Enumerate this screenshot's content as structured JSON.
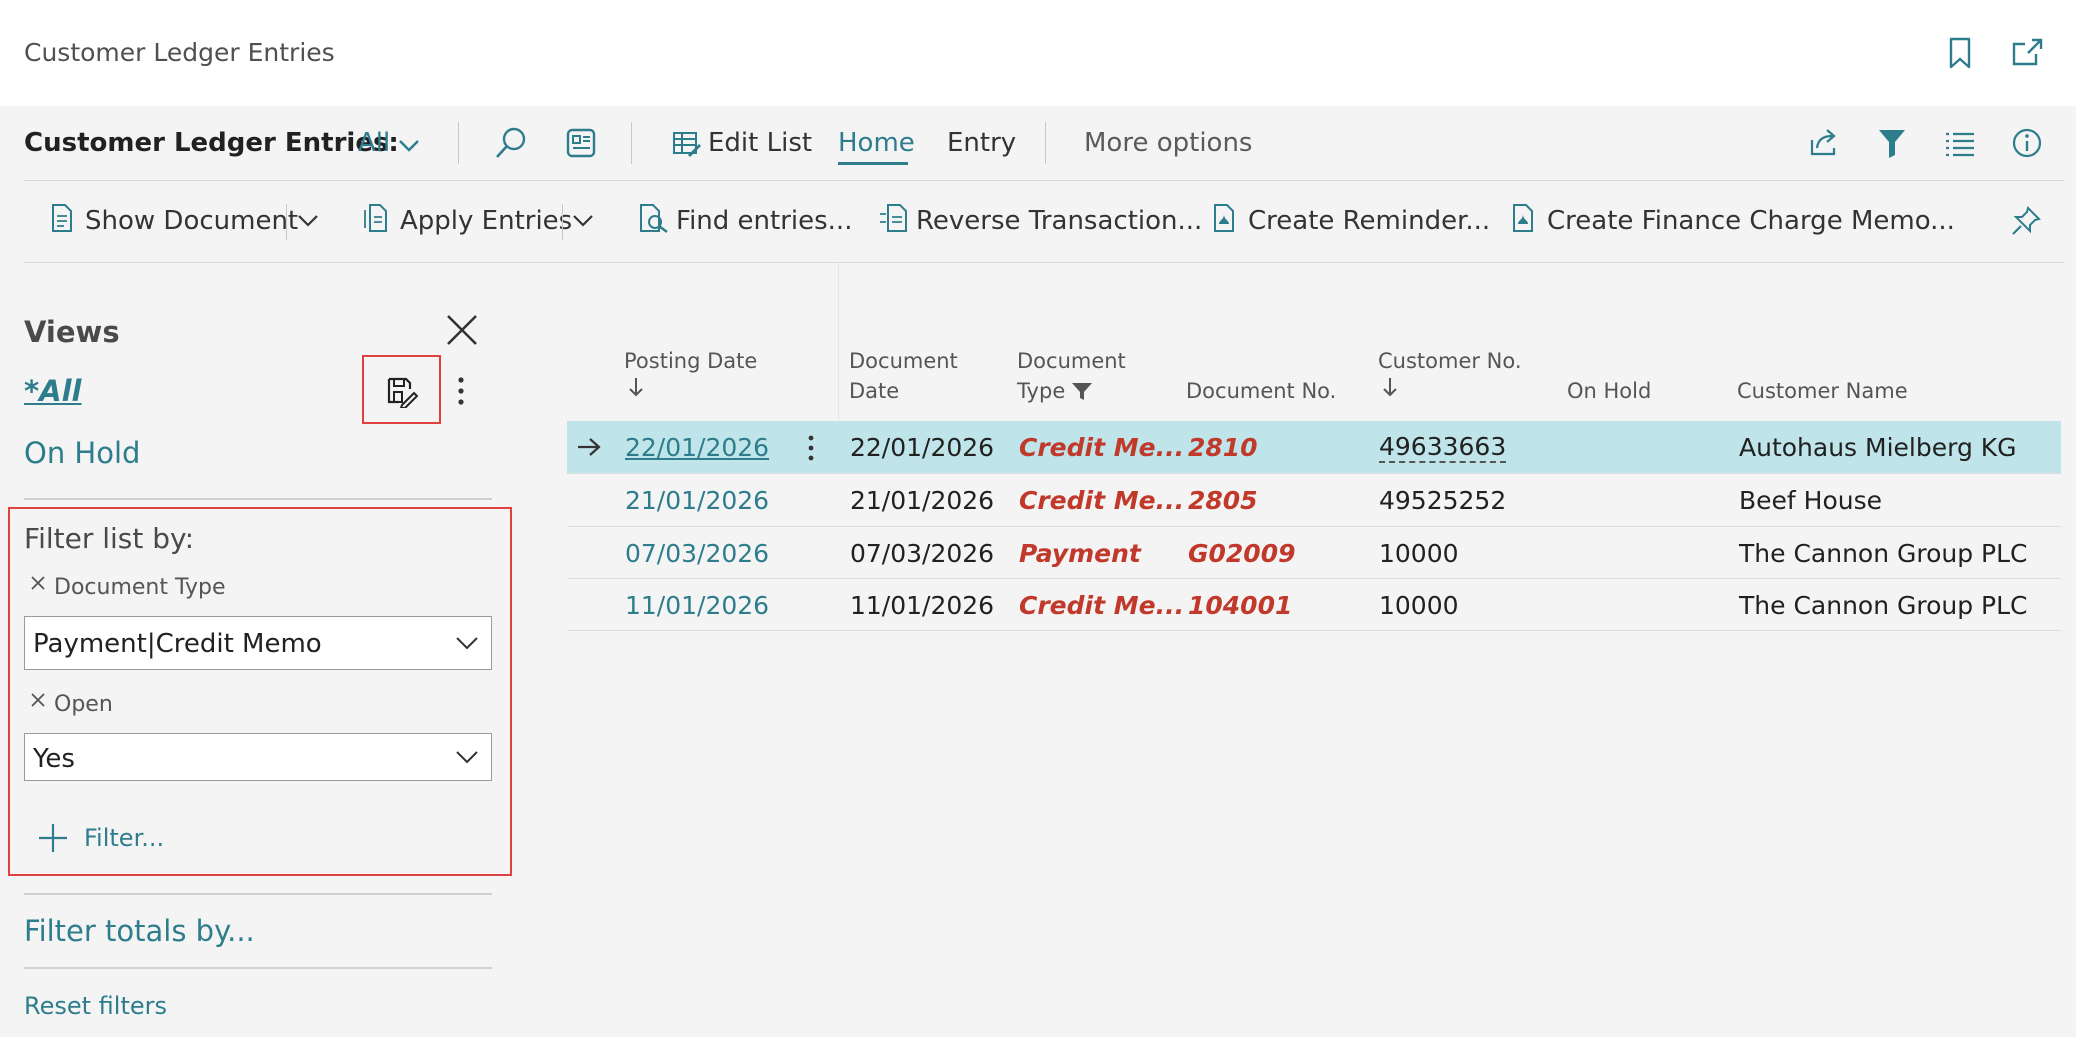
{
  "window": {
    "title": "Customer Ledger Entries"
  },
  "action_bar": {
    "caption": "Customer Ledger Entries:",
    "current_view": "All",
    "edit_list": "Edit List",
    "tab_home": "Home",
    "tab_entry": "Entry",
    "more_options": "More options"
  },
  "promoted_actions": {
    "show_document": "Show Document",
    "apply_entries": "Apply Entries",
    "find_entries": "Find entries...",
    "reverse_transaction": "Reverse Transaction...",
    "create_reminder": "Create Reminder...",
    "create_finance_charge_memo": "Create Finance Charge Memo..."
  },
  "views_pane": {
    "title": "Views",
    "views": [
      "*All",
      "On Hold"
    ],
    "filter_list_by": "Filter list by:",
    "filters": [
      {
        "field": "Document Type",
        "value": "Payment|Credit Memo"
      },
      {
        "field": "Open",
        "value": "Yes"
      }
    ],
    "add_filter": "Filter...",
    "filter_totals_by": "Filter totals by...",
    "reset_filters": "Reset filters"
  },
  "grid": {
    "columns": {
      "posting_date": "Posting Date",
      "document_date_1": "Document",
      "document_date_2": "Date",
      "document_type_1": "Document",
      "document_type_2": "Type",
      "document_no": "Document No.",
      "customer_no": "Customer No.",
      "on_hold": "On Hold",
      "customer_name": "Customer Name"
    },
    "rows": [
      {
        "posting_date": "22/01/2026",
        "document_date": "22/01/2026",
        "document_type": "Credit Me...",
        "document_no": "2810",
        "customer_no": "49633663",
        "on_hold": "",
        "customer_name": "Autohaus Mielberg KG"
      },
      {
        "posting_date": "21/01/2026",
        "document_date": "21/01/2026",
        "document_type": "Credit Me...",
        "document_no": "2805",
        "customer_no": "49525252",
        "on_hold": "",
        "customer_name": "Beef House"
      },
      {
        "posting_date": "07/03/2026",
        "document_date": "07/03/2026",
        "document_type": "Payment",
        "document_no": "G02009",
        "customer_no": "10000",
        "on_hold": "",
        "customer_name": "The Cannon Group PLC"
      },
      {
        "posting_date": "11/01/2026",
        "document_date": "11/01/2026",
        "document_type": "Credit Me...",
        "document_no": "104001",
        "customer_no": "10000",
        "on_hold": "",
        "customer_name": "The Cannon Group PLC"
      }
    ]
  },
  "colors": {
    "accent": "#2d7d8c",
    "selected_row": "#bfe5ea",
    "highlight_border": "#e04040",
    "doc_red": "#c0392b"
  }
}
